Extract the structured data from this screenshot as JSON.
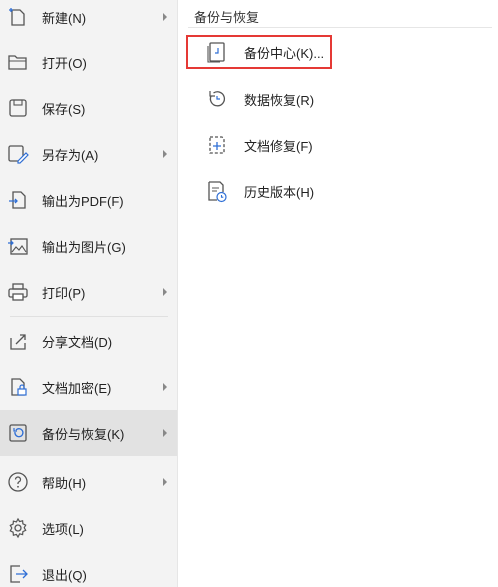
{
  "menu": {
    "items": [
      {
        "label": "新建(N)",
        "icon": "new-file-icon",
        "has_submenu": true
      },
      {
        "label": "打开(O)",
        "icon": "folder-open-icon",
        "has_submenu": false
      },
      {
        "label": "保存(S)",
        "icon": "save-icon",
        "has_submenu": false
      },
      {
        "label": "另存为(A)",
        "icon": "save-as-icon",
        "has_submenu": true
      },
      {
        "label": "输出为PDF(F)",
        "icon": "export-pdf-icon",
        "has_submenu": false
      },
      {
        "label": "输出为图片(G)",
        "icon": "export-image-icon",
        "has_submenu": false
      },
      {
        "label": "打印(P)",
        "icon": "printer-icon",
        "has_submenu": true
      },
      {
        "label": "分享文档(D)",
        "icon": "share-icon",
        "has_submenu": false
      },
      {
        "label": "文档加密(E)",
        "icon": "encrypt-icon",
        "has_submenu": true
      },
      {
        "label": "备份与恢复(K)",
        "icon": "backup-restore-icon",
        "has_submenu": true,
        "selected": true
      },
      {
        "label": "帮助(H)",
        "icon": "help-icon",
        "has_submenu": true
      },
      {
        "label": "选项(L)",
        "icon": "gear-icon",
        "has_submenu": false
      },
      {
        "label": "退出(Q)",
        "icon": "exit-icon",
        "has_submenu": false
      }
    ]
  },
  "submenu": {
    "title": "备份与恢复",
    "items": [
      {
        "label": "备份中心(K)...",
        "icon": "backup-center-icon",
        "highlighted": true
      },
      {
        "label": "数据恢复(R)",
        "icon": "data-recovery-icon"
      },
      {
        "label": "文档修复(F)",
        "icon": "document-repair-icon"
      },
      {
        "label": "历史版本(H)",
        "icon": "history-version-icon"
      }
    ]
  },
  "colors": {
    "highlight_border": "#e53935",
    "selected_bg": "#e2e2e2",
    "panel_bg": "#f3f3f3",
    "icon_accent": "#2f6fd6"
  }
}
